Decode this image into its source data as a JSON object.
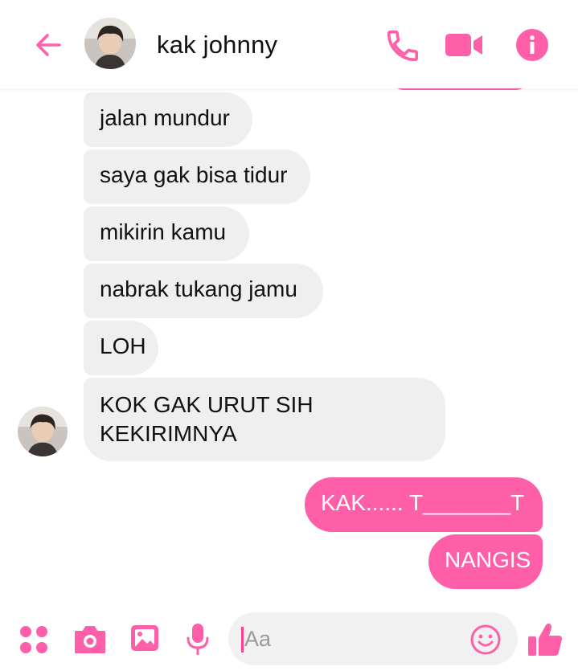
{
  "theme": {
    "accent": "#ff5ea8",
    "received_bg": "#efefef",
    "sent_text": "#ffffff"
  },
  "header": {
    "contact_name": "kak johnny",
    "icons": [
      "back-arrow-icon",
      "phone-icon",
      "video-camera-icon",
      "info-icon"
    ]
  },
  "messages": [
    {
      "direction": "received",
      "text": "jalan mundur"
    },
    {
      "direction": "received",
      "text": "saya gak bisa tidur"
    },
    {
      "direction": "received",
      "text": "mikirin kamu"
    },
    {
      "direction": "received",
      "text": "nabrak tukang jamu"
    },
    {
      "direction": "received",
      "text": "LOH"
    },
    {
      "direction": "received",
      "text": "KOK GAK URUT SIH KEKIRIMNYA"
    },
    {
      "direction": "sent",
      "text": "KAK...... T_______T"
    },
    {
      "direction": "sent",
      "text": "NANGIS"
    }
  ],
  "composer": {
    "placeholder": "Aa",
    "icons": [
      "apps-icon",
      "camera-icon",
      "gallery-icon",
      "microphone-icon",
      "emoji-icon",
      "thumbs-up-icon"
    ]
  }
}
